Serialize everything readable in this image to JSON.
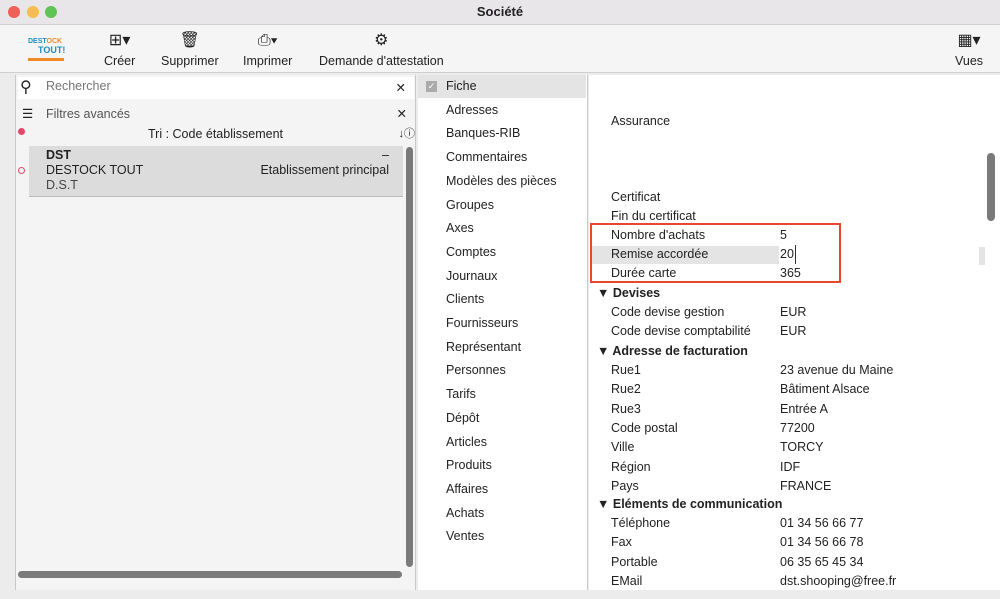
{
  "window": {
    "title": "Société"
  },
  "toolbar": {
    "logo": "DESTOCK TOUT!",
    "create": "Créer",
    "delete": "Supprimer",
    "print": "Imprimer",
    "attest": "Demande d'attestation",
    "views": "Vues"
  },
  "left": {
    "search_placeholder": "Rechercher",
    "filters": "Filtres avancés",
    "sort": "Tri : Code établissement",
    "record": {
      "code": "DST",
      "name": "DESTOCK TOUT",
      "short": "D.S.T",
      "dash": "–",
      "type": "Etablissement principal"
    }
  },
  "nav": [
    "Fiche",
    "Adresses",
    "Banques-RIB",
    "Commentaires",
    "Modèles des pièces",
    "Groupes",
    "Axes",
    "Comptes",
    "Journaux",
    "Clients",
    "Fournisseurs",
    "Représentant",
    "Personnes",
    "Tarifs",
    "Dépôt",
    "Articles",
    "Produits",
    "Affaires",
    "Achats",
    "Ventes"
  ],
  "form": {
    "assurance": "Assurance",
    "certificat": "Certificat",
    "fin_certificat": "Fin du certificat",
    "nb_achats": {
      "label": "Nombre d'achats",
      "value": "5"
    },
    "remise": {
      "label": "Remise accordée",
      "value": "20"
    },
    "duree": {
      "label": "Durée carte",
      "value": "365"
    },
    "devises": {
      "title": "Devises",
      "gestion": {
        "label": "Code devise gestion",
        "value": "EUR"
      },
      "compta": {
        "label": "Code devise comptabilité",
        "value": "EUR"
      }
    },
    "adresse": {
      "title": "Adresse de facturation",
      "rows": [
        {
          "label": "Rue1",
          "value": "23 avenue du Maine"
        },
        {
          "label": "Rue2",
          "value": "Bâtiment Alsace"
        },
        {
          "label": "Rue3",
          "value": "Entrée A"
        },
        {
          "label": "Code postal",
          "value": "77200"
        },
        {
          "label": "Ville",
          "value": "TORCY"
        },
        {
          "label": "Région",
          "value": "IDF"
        },
        {
          "label": "Pays",
          "value": "FRANCE"
        }
      ]
    },
    "comm": {
      "title": "Eléments de communication",
      "rows": [
        {
          "label": "Téléphone",
          "value": "01 34 56 66 77"
        },
        {
          "label": "Fax",
          "value": "01 34 56 66 78"
        },
        {
          "label": "Portable",
          "value": "06 35 65 45 34"
        },
        {
          "label": "EMail",
          "value": "dst.shooping@free.fr"
        }
      ]
    }
  },
  "colors": {
    "highlight": "#e8472a",
    "selected_row": "#dcdcdc"
  }
}
